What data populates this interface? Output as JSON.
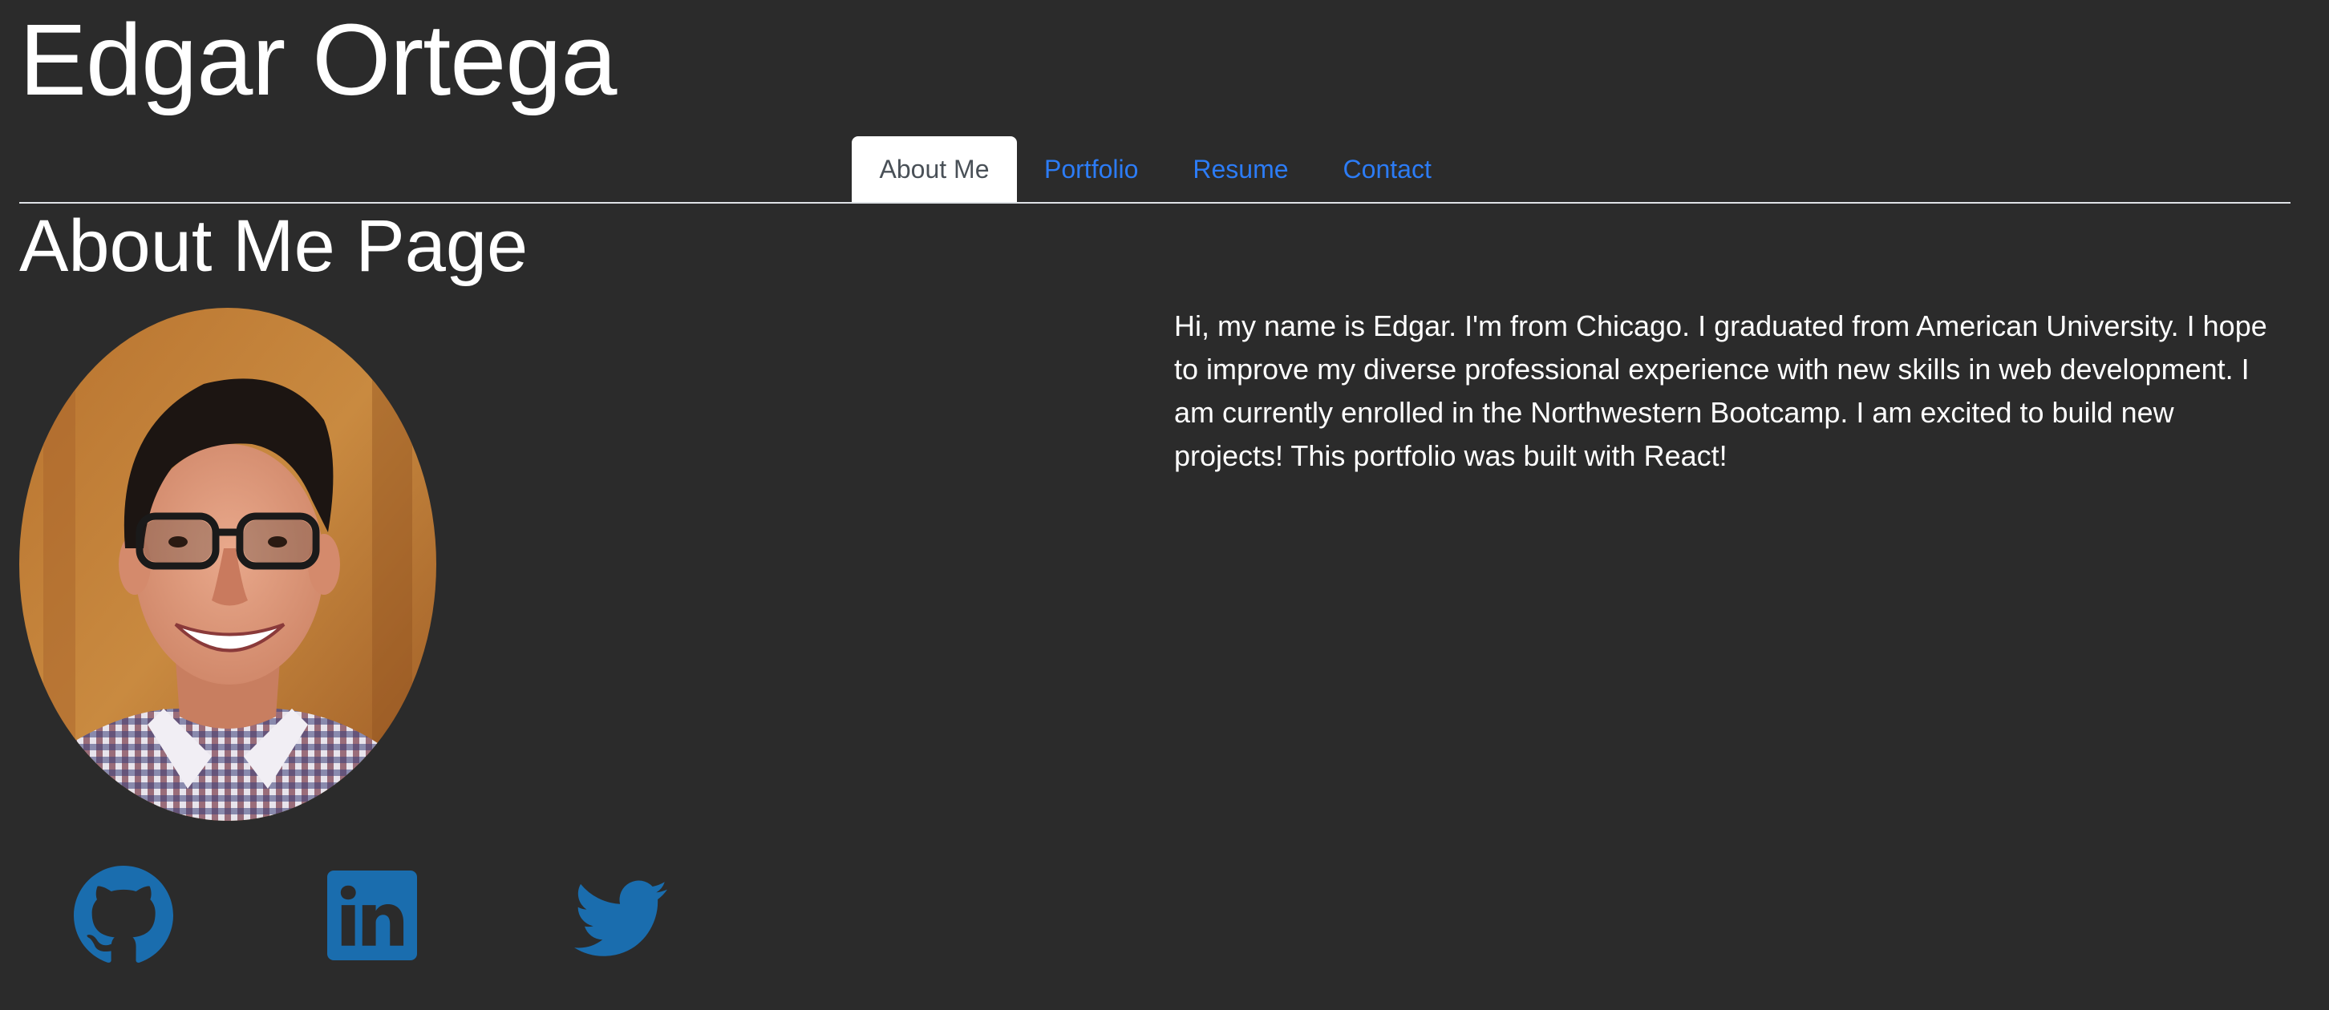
{
  "header": {
    "title": "Edgar Ortega"
  },
  "nav": {
    "tabs": [
      {
        "label": "About Me",
        "active": true
      },
      {
        "label": "Portfolio",
        "active": false
      },
      {
        "label": "Resume",
        "active": false
      },
      {
        "label": "Contact",
        "active": false
      }
    ]
  },
  "main": {
    "heading": "About Me Page",
    "bio": "Hi, my name is Edgar. I'm from Chicago. I graduated from American University. I hope to improve my diverse professional experience with new skills in web development. I am currently enrolled in the Northwestern Bootcamp. I am excited to build new projects! This portfolio was built with React!"
  },
  "social": {
    "icons": [
      "github-icon",
      "linkedin-icon",
      "twitter-icon"
    ]
  },
  "colors": {
    "background": "#2b2b2b",
    "link": "#2c7cf6",
    "social_icon": "#1a6dae"
  }
}
